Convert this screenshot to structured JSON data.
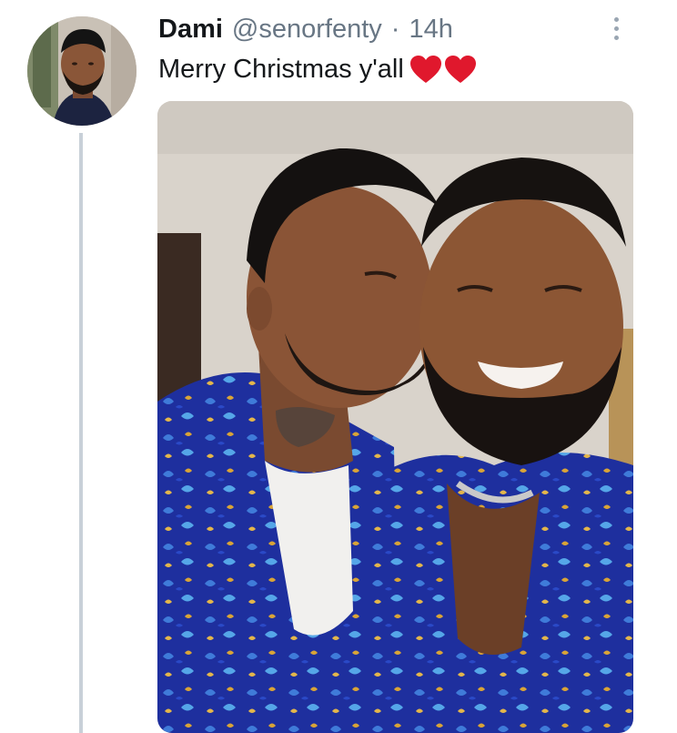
{
  "tweet": {
    "display_name": "Dami",
    "handle": "@senorfenty",
    "separator": "·",
    "time": "14h",
    "text": "Merry Christmas y'all",
    "emoji": [
      "heart-emoji",
      "heart-emoji"
    ]
  },
  "icons": {
    "more": "more-vertical-icon",
    "heart": "red-heart"
  },
  "colors": {
    "name": "#14171a",
    "secondary_text": "#687684",
    "thread_line": "#c8d0d8",
    "heart": "#e0182d",
    "shirt": "#1e2f9e"
  }
}
